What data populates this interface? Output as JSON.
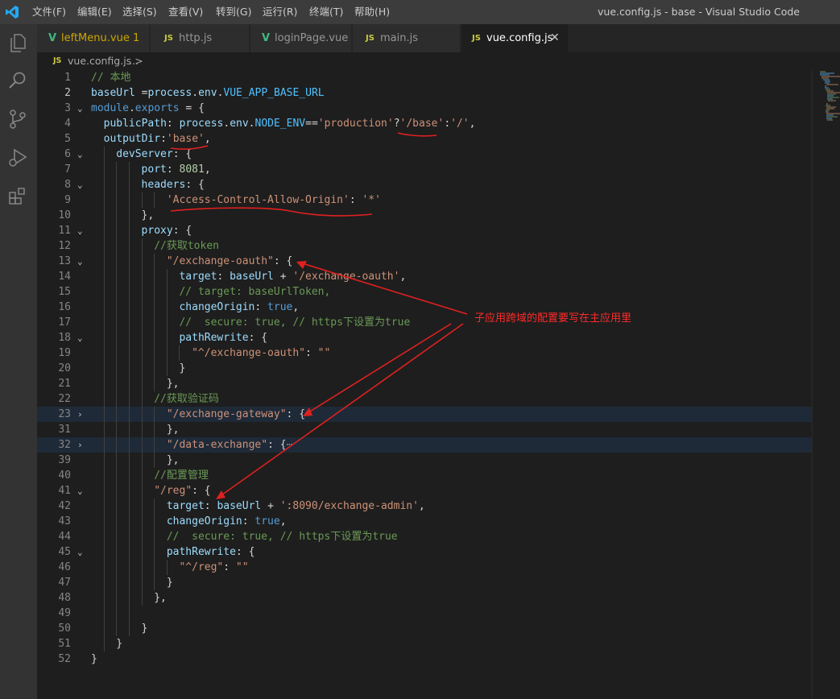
{
  "window": {
    "title": "vue.config.js - base - Visual Studio Code",
    "menu": [
      "文件(F)",
      "编辑(E)",
      "选择(S)",
      "查看(V)",
      "转到(G)",
      "运行(R)",
      "终端(T)",
      "帮助(H)"
    ]
  },
  "activity_bar": {
    "icons": [
      "explorer-icon",
      "search-icon",
      "source-control-icon",
      "run-debug-icon",
      "extensions-icon"
    ]
  },
  "tabs": [
    {
      "label": "leftMenu.vue",
      "badge": "1",
      "icon": "V",
      "type": "vue"
    },
    {
      "label": "http.js",
      "icon": "JS",
      "type": "js"
    },
    {
      "label": "loginPage.vue",
      "icon": "V",
      "type": "vue"
    },
    {
      "label": "main.js",
      "icon": "JS",
      "type": "js"
    },
    {
      "label": "vue.config.js",
      "icon": "JS",
      "type": "js",
      "active": true,
      "close": "✕"
    }
  ],
  "breadcrumb": {
    "icon": "JS",
    "file": "vue.config.js",
    "separator": ">",
    "more": "..."
  },
  "annotation": {
    "text": "子应用跨域的配置要写在主应用里",
    "color": "#ff2a2a"
  },
  "editor": {
    "lines": [
      {
        "n": "1",
        "indent": 0,
        "tokens": [
          [
            "cm",
            "// 本地"
          ]
        ]
      },
      {
        "n": "2",
        "indent": 0,
        "tokens": [
          [
            "v",
            "baseUrl"
          ],
          [
            "p",
            " ="
          ],
          [
            "v",
            "process"
          ],
          [
            "p",
            "."
          ],
          [
            "v",
            "env"
          ],
          [
            "p",
            "."
          ],
          [
            "c",
            "VUE_APP_BASE_URL"
          ]
        ]
      },
      {
        "n": "3",
        "indent": 0,
        "fold": "⌄",
        "tokens": [
          [
            "k",
            "module"
          ],
          [
            "p",
            "."
          ],
          [
            "k",
            "exports"
          ],
          [
            "p",
            " = {"
          ]
        ]
      },
      {
        "n": "4",
        "indent": 1,
        "tokens": [
          [
            "v",
            "publicPath"
          ],
          [
            "p",
            ": "
          ],
          [
            "v",
            "process"
          ],
          [
            "p",
            "."
          ],
          [
            "v",
            "env"
          ],
          [
            "p",
            "."
          ],
          [
            "c",
            "NODE_ENV"
          ],
          [
            "p",
            "=="
          ],
          [
            "s",
            "'production'"
          ],
          [
            "p",
            "?"
          ],
          [
            "s",
            "'/base'"
          ],
          [
            "p",
            ":"
          ],
          [
            "s",
            "'/'"
          ],
          [
            "p",
            ","
          ]
        ]
      },
      {
        "n": "5",
        "indent": 1,
        "tokens": [
          [
            "v",
            "outputDir"
          ],
          [
            "p",
            ":"
          ],
          [
            "s",
            "'base'"
          ],
          [
            "p",
            ","
          ]
        ]
      },
      {
        "n": "6",
        "indent": 2,
        "fold": "⌄",
        "tokens": [
          [
            "v",
            "devServer"
          ],
          [
            "p",
            ": {"
          ]
        ]
      },
      {
        "n": "7",
        "indent": 4,
        "tokens": [
          [
            "v",
            "port"
          ],
          [
            "p",
            ": "
          ],
          [
            "n",
            "8081"
          ],
          [
            "p",
            ","
          ]
        ]
      },
      {
        "n": "8",
        "indent": 4,
        "fold": "⌄",
        "tokens": [
          [
            "v",
            "headers"
          ],
          [
            "p",
            ": {"
          ]
        ]
      },
      {
        "n": "9",
        "indent": 6,
        "tokens": [
          [
            "s",
            "'Access-Control-Allow-Origin'"
          ],
          [
            "p",
            ": "
          ],
          [
            "s",
            "'*'"
          ]
        ]
      },
      {
        "n": "10",
        "indent": 4,
        "tokens": [
          [
            "p",
            "},"
          ]
        ]
      },
      {
        "n": "11",
        "indent": 4,
        "fold": "⌄",
        "tokens": [
          [
            "v",
            "proxy"
          ],
          [
            "p",
            ": {"
          ]
        ]
      },
      {
        "n": "12",
        "indent": 5,
        "tokens": [
          [
            "cm",
            "//获取token"
          ]
        ]
      },
      {
        "n": "13",
        "indent": 6,
        "fold": "⌄",
        "tokens": [
          [
            "s",
            "\"/exchange-oauth\""
          ],
          [
            "p",
            ": {"
          ]
        ]
      },
      {
        "n": "14",
        "indent": 7,
        "tokens": [
          [
            "v",
            "target"
          ],
          [
            "p",
            ": "
          ],
          [
            "v",
            "baseUrl"
          ],
          [
            "p",
            " + "
          ],
          [
            "s",
            "'/exchange-oauth'"
          ],
          [
            "p",
            ","
          ]
        ]
      },
      {
        "n": "15",
        "indent": 7,
        "tokens": [
          [
            "cm",
            "// target: baseUrlToken,"
          ]
        ]
      },
      {
        "n": "16",
        "indent": 7,
        "tokens": [
          [
            "v",
            "changeOrigin"
          ],
          [
            "p",
            ": "
          ],
          [
            "k",
            "true"
          ],
          [
            "p",
            ","
          ]
        ]
      },
      {
        "n": "17",
        "indent": 7,
        "tokens": [
          [
            "cm",
            "//  secure: true, // https下设置为true"
          ]
        ]
      },
      {
        "n": "18",
        "indent": 7,
        "fold": "⌄",
        "tokens": [
          [
            "v",
            "pathRewrite"
          ],
          [
            "p",
            ": {"
          ]
        ]
      },
      {
        "n": "19",
        "indent": 8,
        "tokens": [
          [
            "s",
            "\"^/exchange-oauth\""
          ],
          [
            "p",
            ": "
          ],
          [
            "s",
            "\"\""
          ]
        ]
      },
      {
        "n": "20",
        "indent": 7,
        "tokens": [
          [
            "p",
            "}"
          ]
        ]
      },
      {
        "n": "21",
        "indent": 6,
        "tokens": [
          [
            "p",
            "},"
          ]
        ]
      },
      {
        "n": "22",
        "indent": 5,
        "tokens": [
          [
            "cm",
            "//获取验证码"
          ]
        ]
      },
      {
        "n": "23",
        "indent": 6,
        "fold": "›",
        "hl": true,
        "tokens": [
          [
            "s",
            "\"/exchange-gateway\""
          ],
          [
            "p",
            ": {"
          ],
          [
            "e",
            "⋯"
          ]
        ]
      },
      {
        "n": "31",
        "indent": 6,
        "tokens": [
          [
            "p",
            "},"
          ]
        ]
      },
      {
        "n": "32",
        "indent": 6,
        "fold": "›",
        "hl": true,
        "tokens": [
          [
            "s",
            "\"/data-exchange\""
          ],
          [
            "p",
            ": {"
          ],
          [
            "e",
            "⋯"
          ]
        ]
      },
      {
        "n": "39",
        "indent": 6,
        "tokens": [
          [
            "p",
            "},"
          ]
        ]
      },
      {
        "n": "40",
        "indent": 5,
        "tokens": [
          [
            "cm",
            "//配置管理"
          ]
        ]
      },
      {
        "n": "41",
        "indent": 5,
        "fold": "⌄",
        "tokens": [
          [
            "s",
            "\"/reg\""
          ],
          [
            "p",
            ": {"
          ]
        ]
      },
      {
        "n": "42",
        "indent": 6,
        "tokens": [
          [
            "v",
            "target"
          ],
          [
            "p",
            ": "
          ],
          [
            "v",
            "baseUrl"
          ],
          [
            "p",
            " + "
          ],
          [
            "s",
            "':8090/exchange-admin'"
          ],
          [
            "p",
            ","
          ]
        ]
      },
      {
        "n": "43",
        "indent": 6,
        "tokens": [
          [
            "v",
            "changeOrigin"
          ],
          [
            "p",
            ": "
          ],
          [
            "k",
            "true"
          ],
          [
            "p",
            ","
          ]
        ]
      },
      {
        "n": "44",
        "indent": 6,
        "tokens": [
          [
            "cm",
            "//  secure: true, // https下设置为true"
          ]
        ]
      },
      {
        "n": "45",
        "indent": 6,
        "fold": "⌄",
        "tokens": [
          [
            "v",
            "pathRewrite"
          ],
          [
            "p",
            ": {"
          ]
        ]
      },
      {
        "n": "46",
        "indent": 7,
        "tokens": [
          [
            "s",
            "\"^/reg\""
          ],
          [
            "p",
            ": "
          ],
          [
            "s",
            "\"\""
          ]
        ]
      },
      {
        "n": "47",
        "indent": 6,
        "tokens": [
          [
            "p",
            "}"
          ]
        ]
      },
      {
        "n": "48",
        "indent": 5,
        "tokens": [
          [
            "p",
            "},"
          ]
        ]
      },
      {
        "n": "49",
        "indent": 4,
        "tokens": []
      },
      {
        "n": "50",
        "indent": 4,
        "tokens": [
          [
            "p",
            "}"
          ]
        ]
      },
      {
        "n": "51",
        "indent": 2,
        "tokens": [
          [
            "p",
            "}"
          ]
        ]
      },
      {
        "n": "52",
        "indent": 0,
        "tokens": [
          [
            "p",
            "}"
          ]
        ]
      }
    ]
  }
}
